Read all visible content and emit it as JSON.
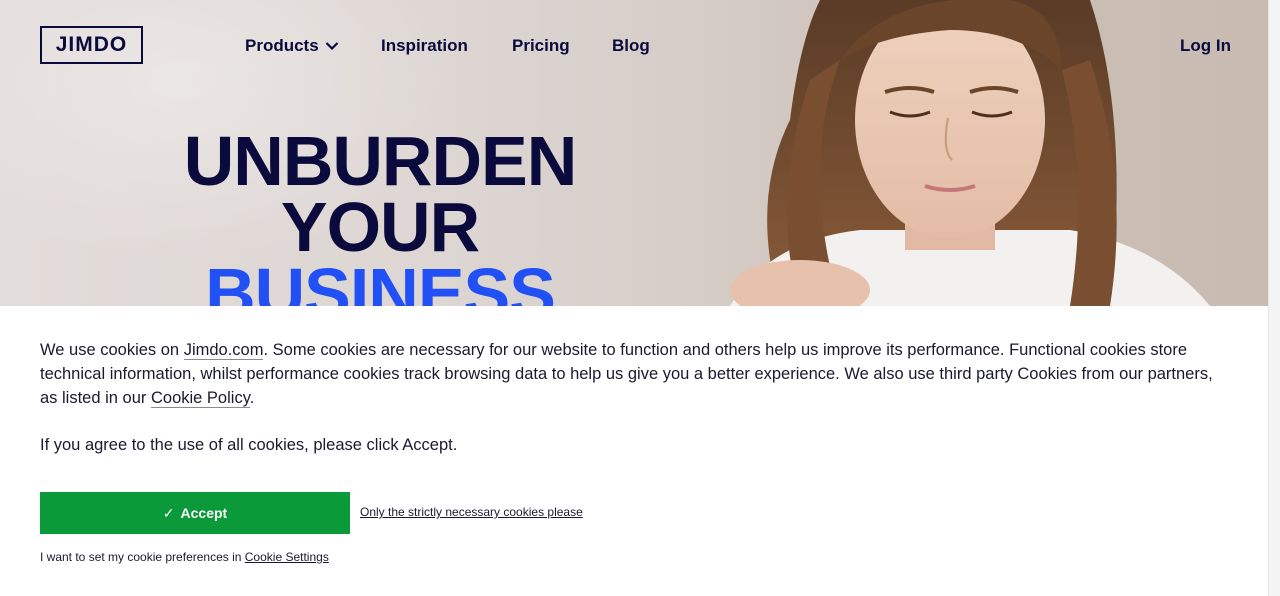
{
  "nav": {
    "logo": "JIMDO",
    "products": "Products",
    "inspiration": "Inspiration",
    "pricing": "Pricing",
    "blog": "Blog",
    "login": "Log In"
  },
  "hero": {
    "line1": "UNBURDEN YOUR",
    "line2": "BUSINESS"
  },
  "cookie": {
    "text_1": "We use cookies on ",
    "site_link": "Jimdo.com",
    "text_2": ". Some cookies are necessary for our website to function and others help us improve its performance. Functional cookies store technical information, whilst performance cookies track browsing data to help us give you a better experience. We also use third party Cookies from our partners, as listed in our ",
    "policy_link": "Cookie Policy",
    "text_3": ".",
    "agree_text": "If you agree to the use of all cookies, please click Accept.",
    "accept_check": "✓",
    "accept_label": "Accept",
    "strict_link": "Only the strictly necessary cookies please",
    "prefs_text": "I want to set my cookie preferences in ",
    "settings_link": "Cookie Settings"
  },
  "colors": {
    "navy": "#0a0a3c",
    "blue": "#2151f5",
    "green": "#0a9a3a"
  }
}
